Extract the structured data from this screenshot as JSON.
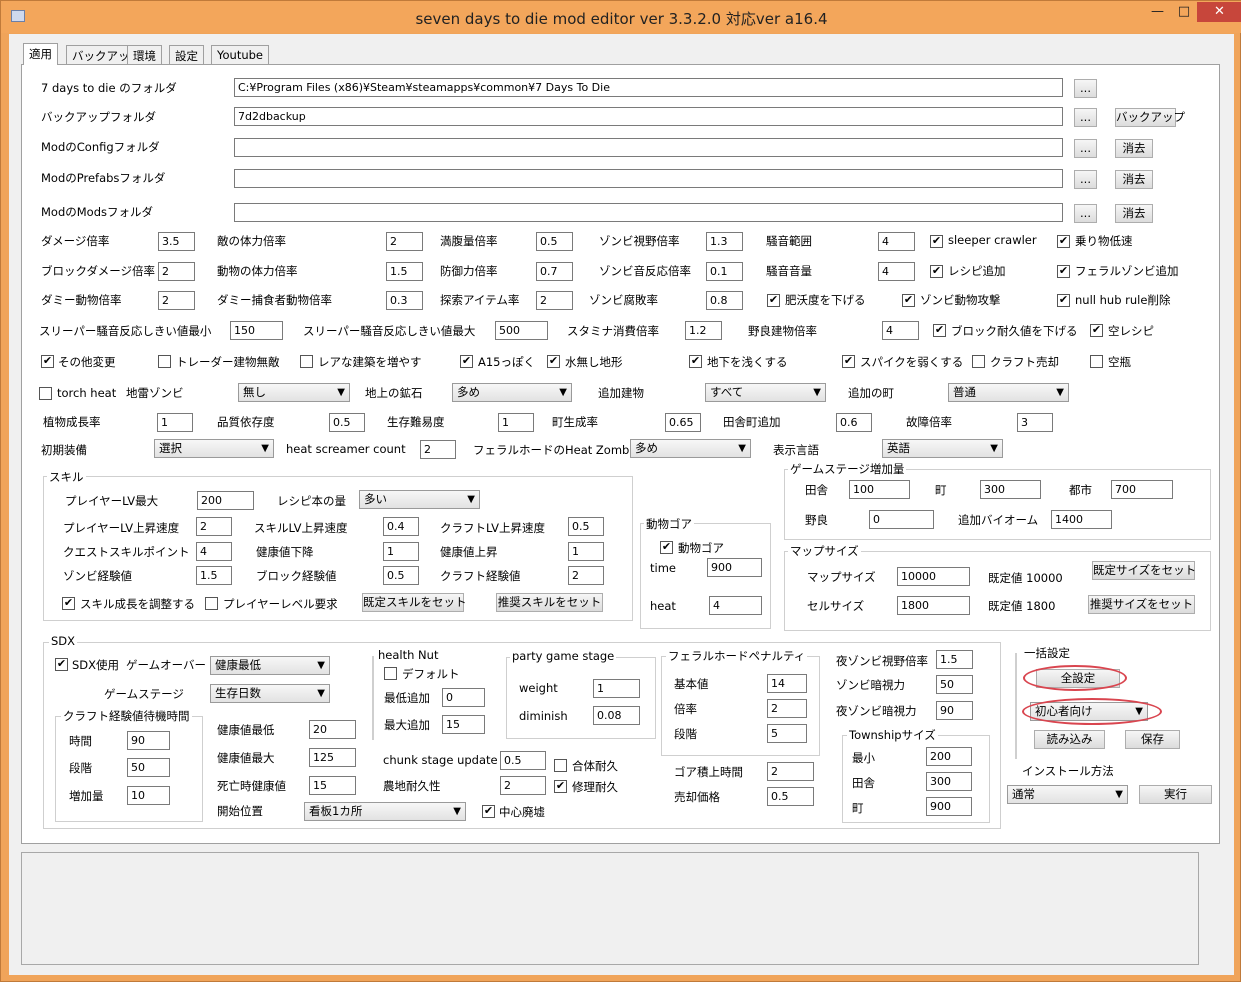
{
  "window": {
    "title": "seven days to die mod editor ver 3.3.2.0 対応ver a16.4",
    "min": "—",
    "max": "□",
    "close": "✕"
  },
  "tabs": [
    "適用",
    "バックアップ",
    "環境",
    "設定",
    "Youtube"
  ],
  "folders": {
    "game": {
      "label": "7 days to die のフォルダ",
      "value": "C:¥Program Files (x86)¥Steam¥steamapps¥common¥7 Days To Die",
      "browse": "..."
    },
    "backup": {
      "label": "バックアップフォルダ",
      "value": "7d2dbackup",
      "browse": "...",
      "action": "バックアップ"
    },
    "config": {
      "label": "ModのConfigフォルダ",
      "value": "",
      "browse": "...",
      "action": "消去"
    },
    "prefabs": {
      "label": "ModのPrefabsフォルダ",
      "value": "",
      "browse": "...",
      "action": "消去"
    },
    "mods": {
      "label": "ModのModsフォルダ",
      "value": "",
      "browse": "...",
      "action": "消去"
    }
  },
  "mult": {
    "r1": [
      {
        "l": "ダメージ倍率",
        "v": "3.5"
      },
      {
        "l": "敵の体力倍率",
        "v": "2"
      },
      {
        "l": "満腹量倍率",
        "v": "0.5"
      },
      {
        "l": "ゾンビ視野倍率",
        "v": "1.3"
      },
      {
        "l": "騒音範囲",
        "v": "4"
      }
    ],
    "r2": [
      {
        "l": "ブロックダメージ倍率",
        "v": "2"
      },
      {
        "l": "動物の体力倍率",
        "v": "1.5"
      },
      {
        "l": "防御力倍率",
        "v": "0.7"
      },
      {
        "l": "ゾンビ音反応倍率",
        "v": "0.1"
      },
      {
        "l": "騒音音量",
        "v": "4"
      }
    ],
    "r3": [
      {
        "l": "ダミー動物倍率",
        "v": "2"
      },
      {
        "l": "ダミー捕食者動物倍率",
        "v": "0.3"
      },
      {
        "l": "探索アイテム率",
        "v": "2"
      },
      {
        "l": "ゾンビ腐敗率",
        "v": "0.8"
      }
    ],
    "r4": [
      {
        "l": "スリーパー騒音反応しきい値最小",
        "v": "150"
      },
      {
        "l": "スリーパー騒音反応しきい値最大",
        "v": "500"
      },
      {
        "l": "スタミナ消費倍率",
        "v": "1.2"
      },
      {
        "l": "野良建物倍率",
        "v": "4"
      }
    ]
  },
  "checks": {
    "sleeper": "sleeper crawler",
    "vehicle": "乗り物低速",
    "recipe_add": "レシピ追加",
    "feral_add": "フェラルゾンビ追加",
    "fertility": "肥沃度を下げる",
    "zombie_animal": "ゾンビ動物攻撃",
    "nullhub": "null hub rule削除",
    "block_dur": "ブロック耐久値を下げる",
    "empty_recipe": "空レシピ",
    "other": "その他変更",
    "trader": "トレーダー建物無敵",
    "rare": "レアな建築を増やす",
    "a15": "A15っぽく",
    "nowater": "水無し地形",
    "shallow": "地下を浅くする",
    "spike": "スパイクを弱くする",
    "craftsell": "クラフト売却",
    "empty_bottle": "空瓶",
    "torch": "torch heat"
  },
  "dropdowns": {
    "landmine": {
      "label": "地雷ゾンビ",
      "value": "無し"
    },
    "ore": {
      "label": "地上の鉱石",
      "value": "多め"
    },
    "building": {
      "label": "追加建物",
      "value": "すべて"
    },
    "town": {
      "label": "追加の町",
      "value": "普通"
    }
  },
  "row5": [
    {
      "l": "植物成長率",
      "v": "1"
    },
    {
      "l": "品質依存度",
      "v": "0.5"
    },
    {
      "l": "生存難易度",
      "v": "1"
    },
    {
      "l": "町生成率",
      "v": "0.65"
    },
    {
      "l": "田舎町追加",
      "v": "0.6"
    },
    {
      "l": "故障倍率",
      "v": "3"
    }
  ],
  "row6": {
    "equip_label": "初期装備",
    "equip": "選択",
    "screamer_label": "heat screamer count",
    "screamer": "2",
    "feral_label": "フェラルホードのHeat Zombie量",
    "feral": "多め",
    "lang_label": "表示言語",
    "lang": "英語"
  },
  "skill": {
    "title": "スキル",
    "maxlv_l": "プレイヤーLV最大",
    "maxlv": "200",
    "book_l": "レシピ本の量",
    "book": "多い",
    "rows": [
      [
        {
          "l": "プレイヤーLV上昇速度",
          "v": "2"
        },
        {
          "l": "スキルLV上昇速度",
          "v": "0.4"
        },
        {
          "l": "クラフトLV上昇速度",
          "v": "0.5"
        }
      ],
      [
        {
          "l": "クエストスキルポイント",
          "v": "4"
        },
        {
          "l": "健康値下降",
          "v": "1"
        },
        {
          "l": "健康値上昇",
          "v": "1"
        }
      ],
      [
        {
          "l": "ゾンビ経験値",
          "v": "1.5"
        },
        {
          "l": "ブロック経験値",
          "v": "0.5"
        },
        {
          "l": "クラフト経験値",
          "v": "2"
        }
      ]
    ],
    "adjust": "スキル成長を調整する",
    "plvreq": "プレイヤーレベル要求",
    "default_btn": "既定スキルをセット",
    "recommend_btn": "推奨スキルをセット"
  },
  "gore": {
    "title": "動物ゴア",
    "check": "動物ゴア",
    "time_l": "time",
    "time": "900",
    "heat_l": "heat",
    "heat": "4"
  },
  "gamestage": {
    "title": "ゲームステージ増加量",
    "inaka_l": "田舎",
    "inaka": "100",
    "machi_l": "町",
    "machi": "300",
    "toshi_l": "都市",
    "toshi": "700",
    "nora_l": "野良",
    "nora": "0",
    "biome_l": "追加バイオーム",
    "biome": "1400"
  },
  "mapsize": {
    "title": "マップサイズ",
    "map_l": "マップサイズ",
    "map": "10000",
    "map_def": "既定値 10000",
    "map_btn": "既定サイズをセット",
    "cell_l": "セルサイズ",
    "cell": "1800",
    "cell_def": "既定値 1800",
    "cell_btn": "推奨サイズをセット"
  },
  "sdx": {
    "title": "SDX",
    "use": "SDX使用",
    "gameover_l": "ゲームオーバー",
    "gameover": "健康最低",
    "stage_l": "ゲームステージ",
    "stage": "生存日数",
    "craft_title": "クラフト経験値待機時間",
    "jikan_l": "時間",
    "jikan": "90",
    "dankai_l": "段階",
    "dankai": "50",
    "zoka_l": "増加量",
    "zoka": "10",
    "hmin_l": "健康値最低",
    "hmin": "20",
    "hmax_l": "健康値最大",
    "hmax": "125",
    "death_l": "死亡時健康値",
    "death": "15",
    "start_l": "開始位置",
    "start": "看板1カ所",
    "center": "中心廃墟",
    "nut_title": "health Nut",
    "nut_default": "デフォルト",
    "nut_min_l": "最低追加",
    "nut_min": "0",
    "nut_max_l": "最大追加",
    "nut_max": "15",
    "party_title": "party game stage",
    "weight_l": "weight",
    "weight": "1",
    "dim_l": "diminish",
    "dim": "0.08",
    "chunk_l": "chunk stage update",
    "chunk": "0.5",
    "farm_l": "農地耐久性",
    "farm": "2",
    "merge": "合体耐久",
    "repair": "修理耐久",
    "feral_title": "フェラルホードペナルティ",
    "base_l": "基本値",
    "base": "14",
    "mult_l": "倍率",
    "mult": "2",
    "step_l": "段階",
    "step": "5",
    "goreacc_l": "ゴア積上時間",
    "goreacc": "2",
    "sell_l": "売却価格",
    "sell": "0.5",
    "nview_l": "夜ゾンビ視野倍率",
    "nview": "1.5",
    "zdark_l": "ゾンビ暗視力",
    "zdark": "50",
    "ndark_l": "夜ゾンビ暗視力",
    "ndark": "90",
    "township_title": "Townshipサイズ",
    "tmin_l": "最小",
    "tmin": "200",
    "tinaka_l": "田舎",
    "tinaka": "300",
    "tmachi_l": "町",
    "tmachi": "900"
  },
  "bulk": {
    "title": "一括設定",
    "all": "全設定",
    "preset": "初心者向け",
    "load": "読み込み",
    "save": "保存",
    "install_l": "インストール方法",
    "install": "通常",
    "run": "実行"
  },
  "log": ""
}
